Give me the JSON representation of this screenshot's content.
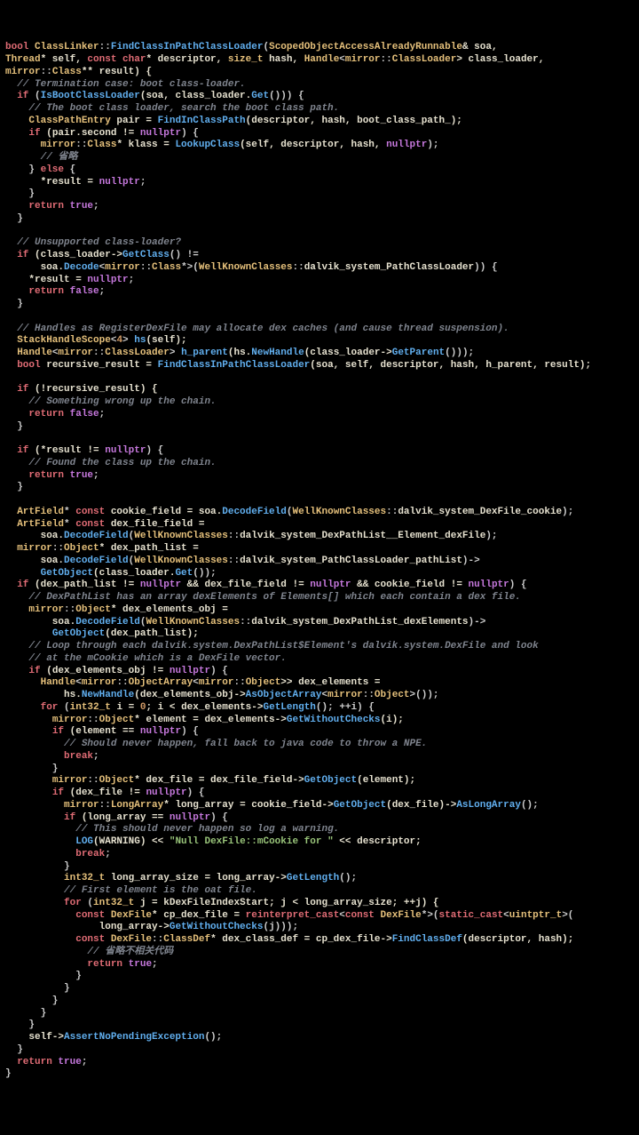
{
  "tokens": [
    [
      [
        "bool ",
        "k"
      ],
      [
        "ClassLinker",
        "ty"
      ],
      [
        "::",
        "op"
      ],
      [
        "FindClassInPathClassLoader",
        "fn"
      ],
      [
        "(",
        "op"
      ],
      [
        "ScopedObjectAccessAlreadyRunnable",
        "ty"
      ],
      [
        "& soa,",
        "id"
      ]
    ],
    [
      [
        "Thread",
        "ty"
      ],
      [
        "* self, ",
        "id"
      ],
      [
        "const char",
        "k"
      ],
      [
        "* descriptor, ",
        "id"
      ],
      [
        "size_t",
        "ty"
      ],
      [
        " hash, ",
        "id"
      ],
      [
        "Handle",
        "ty"
      ],
      [
        "<",
        "op"
      ],
      [
        "mirror",
        "ty"
      ],
      [
        "::",
        "op"
      ],
      [
        "ClassLoader",
        "ty"
      ],
      [
        "> class_loader,",
        "id"
      ]
    ],
    [
      [
        "mirror",
        "ty"
      ],
      [
        "::",
        "op"
      ],
      [
        "Class",
        "ty"
      ],
      [
        "** result) {",
        "id"
      ]
    ],
    [
      [
        "  ",
        "op"
      ],
      [
        "// Termination case: boot class-loader.",
        "cm"
      ]
    ],
    [
      [
        "  ",
        "op"
      ],
      [
        "if ",
        "k"
      ],
      [
        "(",
        "op"
      ],
      [
        "IsBootClassLoader",
        "fn"
      ],
      [
        "(soa, class_loader.",
        "id"
      ],
      [
        "Get",
        "fn"
      ],
      [
        "())) {",
        "op"
      ]
    ],
    [
      [
        "    ",
        "op"
      ],
      [
        "// The boot class loader, search the boot class path.",
        "cm"
      ]
    ],
    [
      [
        "    ",
        "op"
      ],
      [
        "ClassPathEntry",
        "ty"
      ],
      [
        " pair = ",
        "id"
      ],
      [
        "FindInClassPath",
        "fn"
      ],
      [
        "(descriptor, hash, boot_class_path_);",
        "id"
      ]
    ],
    [
      [
        "    ",
        "op"
      ],
      [
        "if ",
        "k"
      ],
      [
        "(pair.second != ",
        "id"
      ],
      [
        "nullptr",
        "np"
      ],
      [
        ") {",
        "op"
      ]
    ],
    [
      [
        "      ",
        "op"
      ],
      [
        "mirror",
        "ty"
      ],
      [
        "::",
        "op"
      ],
      [
        "Class",
        "ty"
      ],
      [
        "* klass = ",
        "id"
      ],
      [
        "LookupClass",
        "fn"
      ],
      [
        "(self, descriptor, hash, ",
        "id"
      ],
      [
        "nullptr",
        "np"
      ],
      [
        ");",
        "op"
      ]
    ],
    [
      [
        "      ",
        "op"
      ],
      [
        "// 省略",
        "cm"
      ]
    ],
    [
      [
        "    } ",
        "op"
      ],
      [
        "else ",
        "k"
      ],
      [
        "{",
        "op"
      ]
    ],
    [
      [
        "      *result = ",
        "id"
      ],
      [
        "nullptr",
        "np"
      ],
      [
        ";",
        "op"
      ]
    ],
    [
      [
        "    }",
        "op"
      ]
    ],
    [
      [
        "    ",
        "op"
      ],
      [
        "return ",
        "k"
      ],
      [
        "true",
        "np"
      ],
      [
        ";",
        "op"
      ]
    ],
    [
      [
        "  }",
        "op"
      ]
    ],
    [
      [
        "",
        "op"
      ]
    ],
    [
      [
        "  ",
        "op"
      ],
      [
        "// Unsupported class-loader?",
        "cm"
      ]
    ],
    [
      [
        "  ",
        "op"
      ],
      [
        "if ",
        "k"
      ],
      [
        "(class_loader->",
        "id"
      ],
      [
        "GetClass",
        "fn"
      ],
      [
        "() !=",
        "op"
      ]
    ],
    [
      [
        "      soa.",
        "id"
      ],
      [
        "Decode",
        "fn"
      ],
      [
        "<",
        "op"
      ],
      [
        "mirror",
        "ty"
      ],
      [
        "::",
        "op"
      ],
      [
        "Class",
        "ty"
      ],
      [
        "*>(",
        "op"
      ],
      [
        "WellKnownClasses",
        "ty"
      ],
      [
        "::",
        "op"
      ],
      [
        "dalvik_system_PathClassLoader",
        "id"
      ],
      [
        ")) {",
        "op"
      ]
    ],
    [
      [
        "    *result = ",
        "id"
      ],
      [
        "nullptr",
        "np"
      ],
      [
        ";",
        "op"
      ]
    ],
    [
      [
        "    ",
        "op"
      ],
      [
        "return ",
        "k"
      ],
      [
        "false",
        "np"
      ],
      [
        ";",
        "op"
      ]
    ],
    [
      [
        "  }",
        "op"
      ]
    ],
    [
      [
        "",
        "op"
      ]
    ],
    [
      [
        "  ",
        "op"
      ],
      [
        "// Handles as RegisterDexFile may allocate dex caches (and cause thread suspension).",
        "cm"
      ]
    ],
    [
      [
        "  ",
        "op"
      ],
      [
        "StackHandleScope",
        "ty"
      ],
      [
        "<",
        "op"
      ],
      [
        "4",
        "num"
      ],
      [
        "> ",
        "op"
      ],
      [
        "hs",
        "fn"
      ],
      [
        "(self);",
        "id"
      ]
    ],
    [
      [
        "  ",
        "op"
      ],
      [
        "Handle",
        "ty"
      ],
      [
        "<",
        "op"
      ],
      [
        "mirror",
        "ty"
      ],
      [
        "::",
        "op"
      ],
      [
        "ClassLoader",
        "ty"
      ],
      [
        "> ",
        "op"
      ],
      [
        "h_parent",
        "fn"
      ],
      [
        "(hs.",
        "id"
      ],
      [
        "NewHandle",
        "fn"
      ],
      [
        "(class_loader->",
        "id"
      ],
      [
        "GetParent",
        "fn"
      ],
      [
        "()));",
        "op"
      ]
    ],
    [
      [
        "  ",
        "op"
      ],
      [
        "bool ",
        "k"
      ],
      [
        "recursive_result = ",
        "id"
      ],
      [
        "FindClassInPathClassLoader",
        "fn"
      ],
      [
        "(soa, self, descriptor, hash, h_parent, result);",
        "id"
      ]
    ],
    [
      [
        "",
        "op"
      ]
    ],
    [
      [
        "  ",
        "op"
      ],
      [
        "if ",
        "k"
      ],
      [
        "(!recursive_result) {",
        "id"
      ]
    ],
    [
      [
        "    ",
        "op"
      ],
      [
        "// Something wrong up the chain.",
        "cm"
      ]
    ],
    [
      [
        "    ",
        "op"
      ],
      [
        "return ",
        "k"
      ],
      [
        "false",
        "np"
      ],
      [
        ";",
        "op"
      ]
    ],
    [
      [
        "  }",
        "op"
      ]
    ],
    [
      [
        "",
        "op"
      ]
    ],
    [
      [
        "  ",
        "op"
      ],
      [
        "if ",
        "k"
      ],
      [
        "(*result != ",
        "id"
      ],
      [
        "nullptr",
        "np"
      ],
      [
        ") {",
        "op"
      ]
    ],
    [
      [
        "    ",
        "op"
      ],
      [
        "// Found the class up the chain.",
        "cm"
      ]
    ],
    [
      [
        "    ",
        "op"
      ],
      [
        "return ",
        "k"
      ],
      [
        "true",
        "np"
      ],
      [
        ";",
        "op"
      ]
    ],
    [
      [
        "  }",
        "op"
      ]
    ],
    [
      [
        "",
        "op"
      ]
    ],
    [
      [
        "  ",
        "op"
      ],
      [
        "ArtField",
        "ty"
      ],
      [
        "* ",
        "op"
      ],
      [
        "const ",
        "k"
      ],
      [
        "cookie_field = soa.",
        "id"
      ],
      [
        "DecodeField",
        "fn"
      ],
      [
        "(",
        "op"
      ],
      [
        "WellKnownClasses",
        "ty"
      ],
      [
        "::",
        "op"
      ],
      [
        "dalvik_system_DexFile_cookie",
        "id"
      ],
      [
        ");",
        "op"
      ]
    ],
    [
      [
        "  ",
        "op"
      ],
      [
        "ArtField",
        "ty"
      ],
      [
        "* ",
        "op"
      ],
      [
        "const ",
        "k"
      ],
      [
        "dex_file_field =",
        "id"
      ]
    ],
    [
      [
        "      soa.",
        "id"
      ],
      [
        "DecodeField",
        "fn"
      ],
      [
        "(",
        "op"
      ],
      [
        "WellKnownClasses",
        "ty"
      ],
      [
        "::",
        "op"
      ],
      [
        "dalvik_system_DexPathList__Element_dexFile",
        "id"
      ],
      [
        ");",
        "op"
      ]
    ],
    [
      [
        "  ",
        "op"
      ],
      [
        "mirror",
        "ty"
      ],
      [
        "::",
        "op"
      ],
      [
        "Object",
        "ty"
      ],
      [
        "* dex_path_list =",
        "id"
      ]
    ],
    [
      [
        "      soa.",
        "id"
      ],
      [
        "DecodeField",
        "fn"
      ],
      [
        "(",
        "op"
      ],
      [
        "WellKnownClasses",
        "ty"
      ],
      [
        "::",
        "op"
      ],
      [
        "dalvik_system_PathClassLoader_pathList",
        "id"
      ],
      [
        ")->",
        "op"
      ]
    ],
    [
      [
        "      ",
        "op"
      ],
      [
        "GetObject",
        "fn"
      ],
      [
        "(class_loader.",
        "id"
      ],
      [
        "Get",
        "fn"
      ],
      [
        "());",
        "op"
      ]
    ],
    [
      [
        "  ",
        "op"
      ],
      [
        "if ",
        "k"
      ],
      [
        "(dex_path_list != ",
        "id"
      ],
      [
        "nullptr",
        "np"
      ],
      [
        " && dex_file_field != ",
        "id"
      ],
      [
        "nullptr",
        "np"
      ],
      [
        " && cookie_field != ",
        "id"
      ],
      [
        "nullptr",
        "np"
      ],
      [
        ") {",
        "op"
      ]
    ],
    [
      [
        "    ",
        "op"
      ],
      [
        "// DexPathList has an array dexElements of Elements[] which each contain a dex file.",
        "cm"
      ]
    ],
    [
      [
        "    ",
        "op"
      ],
      [
        "mirror",
        "ty"
      ],
      [
        "::",
        "op"
      ],
      [
        "Object",
        "ty"
      ],
      [
        "* dex_elements_obj =",
        "id"
      ]
    ],
    [
      [
        "        soa.",
        "id"
      ],
      [
        "DecodeField",
        "fn"
      ],
      [
        "(",
        "op"
      ],
      [
        "WellKnownClasses",
        "ty"
      ],
      [
        "::",
        "op"
      ],
      [
        "dalvik_system_DexPathList_dexElements",
        "id"
      ],
      [
        ")->",
        "op"
      ]
    ],
    [
      [
        "        ",
        "op"
      ],
      [
        "GetObject",
        "fn"
      ],
      [
        "(dex_path_list);",
        "id"
      ]
    ],
    [
      [
        "    ",
        "op"
      ],
      [
        "// Loop through each dalvik.system.DexPathList$Element's dalvik.system.DexFile and look",
        "cm"
      ]
    ],
    [
      [
        "    ",
        "op"
      ],
      [
        "// at the mCookie which is a DexFile vector.",
        "cm"
      ]
    ],
    [
      [
        "    ",
        "op"
      ],
      [
        "if ",
        "k"
      ],
      [
        "(dex_elements_obj != ",
        "id"
      ],
      [
        "nullptr",
        "np"
      ],
      [
        ") {",
        "op"
      ]
    ],
    [
      [
        "      ",
        "op"
      ],
      [
        "Handle",
        "ty"
      ],
      [
        "<",
        "op"
      ],
      [
        "mirror",
        "ty"
      ],
      [
        "::",
        "op"
      ],
      [
        "ObjectArray",
        "ty"
      ],
      [
        "<",
        "op"
      ],
      [
        "mirror",
        "ty"
      ],
      [
        "::",
        "op"
      ],
      [
        "Object",
        "ty"
      ],
      [
        ">> dex_elements =",
        "id"
      ]
    ],
    [
      [
        "          hs.",
        "id"
      ],
      [
        "NewHandle",
        "fn"
      ],
      [
        "(dex_elements_obj->",
        "id"
      ],
      [
        "AsObjectArray",
        "fn"
      ],
      [
        "<",
        "op"
      ],
      [
        "mirror",
        "ty"
      ],
      [
        "::",
        "op"
      ],
      [
        "Object",
        "ty"
      ],
      [
        ">());",
        "op"
      ]
    ],
    [
      [
        "      ",
        "op"
      ],
      [
        "for ",
        "k"
      ],
      [
        "(",
        "op"
      ],
      [
        "int32_t",
        "ty"
      ],
      [
        " i = ",
        "id"
      ],
      [
        "0",
        "num"
      ],
      [
        "; i < dex_elements->",
        "id"
      ],
      [
        "GetLength",
        "fn"
      ],
      [
        "(); ++i) {",
        "op"
      ]
    ],
    [
      [
        "        ",
        "op"
      ],
      [
        "mirror",
        "ty"
      ],
      [
        "::",
        "op"
      ],
      [
        "Object",
        "ty"
      ],
      [
        "* element = dex_elements->",
        "id"
      ],
      [
        "GetWithoutChecks",
        "fn"
      ],
      [
        "(i);",
        "id"
      ]
    ],
    [
      [
        "        ",
        "op"
      ],
      [
        "if ",
        "k"
      ],
      [
        "(element == ",
        "id"
      ],
      [
        "nullptr",
        "np"
      ],
      [
        ") {",
        "op"
      ]
    ],
    [
      [
        "          ",
        "op"
      ],
      [
        "// Should never happen, fall back to java code to throw a NPE.",
        "cm"
      ]
    ],
    [
      [
        "          ",
        "op"
      ],
      [
        "break",
        "k"
      ],
      [
        ";",
        "op"
      ]
    ],
    [
      [
        "        }",
        "op"
      ]
    ],
    [
      [
        "        ",
        "op"
      ],
      [
        "mirror",
        "ty"
      ],
      [
        "::",
        "op"
      ],
      [
        "Object",
        "ty"
      ],
      [
        "* dex_file = dex_file_field->",
        "id"
      ],
      [
        "GetObject",
        "fn"
      ],
      [
        "(element);",
        "id"
      ]
    ],
    [
      [
        "        ",
        "op"
      ],
      [
        "if ",
        "k"
      ],
      [
        "(dex_file != ",
        "id"
      ],
      [
        "nullptr",
        "np"
      ],
      [
        ") {",
        "op"
      ]
    ],
    [
      [
        "          ",
        "op"
      ],
      [
        "mirror",
        "ty"
      ],
      [
        "::",
        "op"
      ],
      [
        "LongArray",
        "ty"
      ],
      [
        "* long_array = cookie_field->",
        "id"
      ],
      [
        "GetObject",
        "fn"
      ],
      [
        "(dex_file)->",
        "id"
      ],
      [
        "AsLongArray",
        "fn"
      ],
      [
        "();",
        "op"
      ]
    ],
    [
      [
        "          ",
        "op"
      ],
      [
        "if ",
        "k"
      ],
      [
        "(long_array == ",
        "id"
      ],
      [
        "nullptr",
        "np"
      ],
      [
        ") {",
        "op"
      ]
    ],
    [
      [
        "            ",
        "op"
      ],
      [
        "// This should never happen so log a warning.",
        "cm"
      ]
    ],
    [
      [
        "            ",
        "op"
      ],
      [
        "LOG",
        "fn"
      ],
      [
        "(WARNING) << ",
        "id"
      ],
      [
        "\"Null DexFile::mCookie for \"",
        "str"
      ],
      [
        " << descriptor;",
        "id"
      ]
    ],
    [
      [
        "            ",
        "op"
      ],
      [
        "break",
        "k"
      ],
      [
        ";",
        "op"
      ]
    ],
    [
      [
        "          }",
        "op"
      ]
    ],
    [
      [
        "          ",
        "op"
      ],
      [
        "int32_t",
        "ty"
      ],
      [
        " long_array_size = long_array->",
        "id"
      ],
      [
        "GetLength",
        "fn"
      ],
      [
        "();",
        "op"
      ]
    ],
    [
      [
        "          ",
        "op"
      ],
      [
        "// First element is the oat file.",
        "cm"
      ]
    ],
    [
      [
        "          ",
        "op"
      ],
      [
        "for ",
        "k"
      ],
      [
        "(",
        "op"
      ],
      [
        "int32_t",
        "ty"
      ],
      [
        " j = kDexFileIndexStart; j < long_array_size; ++j) {",
        "id"
      ]
    ],
    [
      [
        "            ",
        "op"
      ],
      [
        "const ",
        "k"
      ],
      [
        "DexFile",
        "ty"
      ],
      [
        "* cp_dex_file = ",
        "id"
      ],
      [
        "reinterpret_cast",
        "k"
      ],
      [
        "<",
        "op"
      ],
      [
        "const ",
        "k"
      ],
      [
        "DexFile",
        "ty"
      ],
      [
        "*>(",
        "op"
      ],
      [
        "static_cast",
        "k"
      ],
      [
        "<",
        "op"
      ],
      [
        "uintptr_t",
        "ty"
      ],
      [
        ">(",
        "op"
      ]
    ],
    [
      [
        "                long_array->",
        "id"
      ],
      [
        "GetWithoutChecks",
        "fn"
      ],
      [
        "(j)));",
        "op"
      ]
    ],
    [
      [
        "            ",
        "op"
      ],
      [
        "const ",
        "k"
      ],
      [
        "DexFile",
        "ty"
      ],
      [
        "::",
        "op"
      ],
      [
        "ClassDef",
        "ty"
      ],
      [
        "* dex_class_def = cp_dex_file->",
        "id"
      ],
      [
        "FindClassDef",
        "fn"
      ],
      [
        "(descriptor, hash);",
        "id"
      ]
    ],
    [
      [
        "              ",
        "op"
      ],
      [
        "// 省略不相关代码",
        "cm"
      ]
    ],
    [
      [
        "              ",
        "op"
      ],
      [
        "return ",
        "k"
      ],
      [
        "true",
        "np"
      ],
      [
        ";",
        "op"
      ]
    ],
    [
      [
        "            }",
        "op"
      ]
    ],
    [
      [
        "          }",
        "op"
      ]
    ],
    [
      [
        "        }",
        "op"
      ]
    ],
    [
      [
        "      }",
        "op"
      ]
    ],
    [
      [
        "    }",
        "op"
      ]
    ],
    [
      [
        "    self->",
        "id"
      ],
      [
        "AssertNoPendingException",
        "fn"
      ],
      [
        "();",
        "op"
      ]
    ],
    [
      [
        "  }",
        "op"
      ]
    ],
    [
      [
        "  ",
        "op"
      ],
      [
        "return ",
        "k"
      ],
      [
        "true",
        "np"
      ],
      [
        ";",
        "op"
      ]
    ],
    [
      [
        "}",
        "op"
      ]
    ]
  ]
}
